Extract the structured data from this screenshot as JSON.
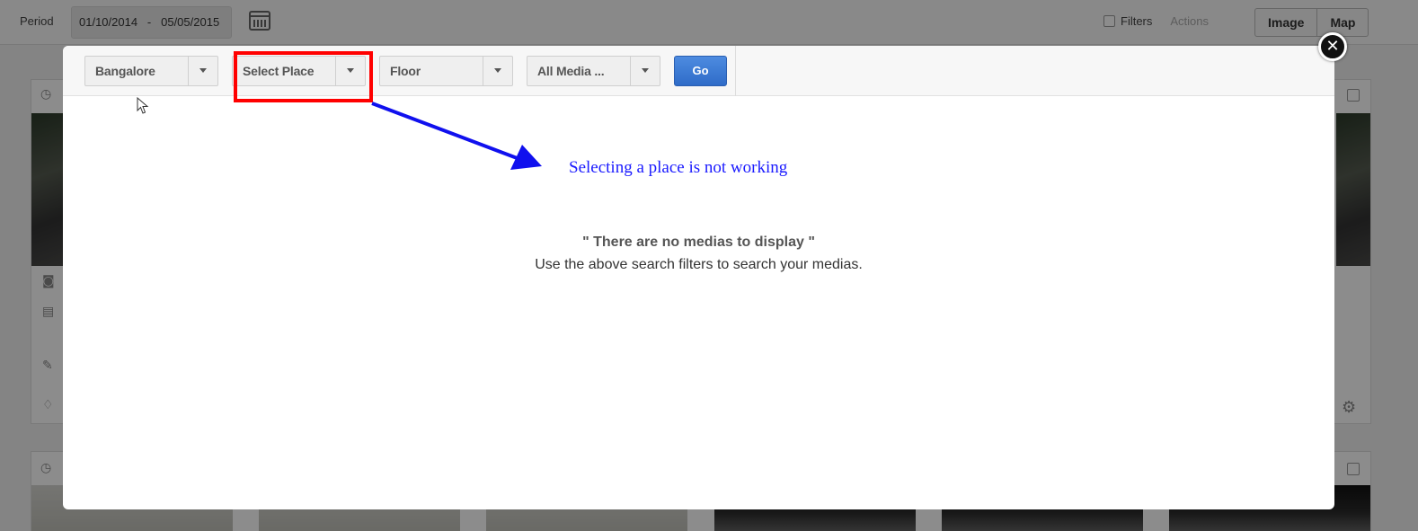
{
  "topbar": {
    "period_label": "Period",
    "date_start": "01/10/2014",
    "date_separator": "-",
    "date_end": "05/05/2015",
    "calendar_icon": "calendar-icon",
    "filters_label": "Filters",
    "actions_label": "Actions",
    "view_buttons": [
      "Image",
      "Map"
    ]
  },
  "modal": {
    "selects": [
      {
        "label": "Bangalore"
      },
      {
        "label": "Select Place"
      },
      {
        "label": "Floor"
      },
      {
        "label": "All Media ..."
      }
    ],
    "go_label": "Go",
    "close_icon": "close-icon",
    "close_glyph": "✕",
    "empty_title": "\" There are no medias to display \"",
    "empty_subtitle": "Use the above search filters to search your medias."
  },
  "annotation": {
    "text": "Selecting a place is not working",
    "color": "#1a1aff",
    "highlight_color": "#ff0000"
  }
}
